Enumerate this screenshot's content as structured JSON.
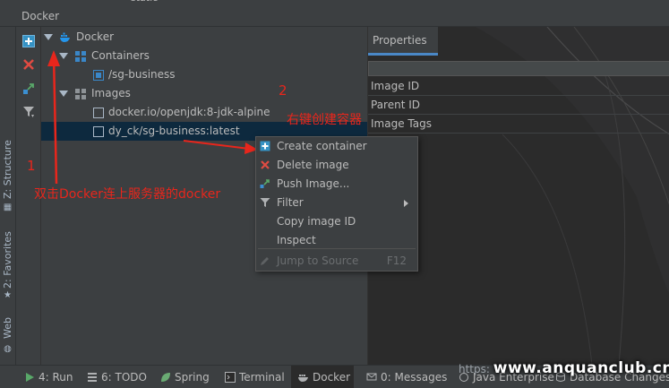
{
  "window": {
    "title": "Docker",
    "top_fragment": "static"
  },
  "left_strip": {
    "tabs": [
      {
        "label": "Z: Structure"
      },
      {
        "label": "2: Favorites"
      },
      {
        "label": "Web"
      }
    ]
  },
  "toolbar": {
    "buttons": [
      {
        "name": "add",
        "icon": "plus-icon"
      },
      {
        "name": "remove",
        "icon": "red-x-icon"
      },
      {
        "name": "connect",
        "icon": "arrow-diagonal-icon"
      },
      {
        "name": "filter",
        "icon": "filter-funnel-icon"
      }
    ]
  },
  "tree": {
    "root": "Docker",
    "containers_label": "Containers",
    "container_item": "/sg-business",
    "images_label": "Images",
    "image_items": [
      "docker.io/openjdk:8-jdk-alpine",
      "dy_ck/sg-business:latest"
    ]
  },
  "properties": {
    "tab_label": "Properties",
    "rows": [
      "Image ID",
      "Parent ID",
      "Image Tags"
    ]
  },
  "context_menu": {
    "items": [
      {
        "label": "Create container",
        "icon": "plus-square-icon"
      },
      {
        "label": "Delete image",
        "icon": "red-x-icon"
      },
      {
        "label": "Push Image...",
        "icon": "push-arrow-icon"
      },
      {
        "label": "Filter",
        "icon": "filter-funnel-icon",
        "submenu": true
      },
      {
        "label": "Copy image ID"
      },
      {
        "label": "Inspect"
      }
    ],
    "jump": {
      "label": "Jump to Source",
      "shortcut": "F12",
      "icon": "pencil-icon",
      "disabled": true
    }
  },
  "annotations": {
    "step1_number": "1",
    "step1_text": "双击Docker连上服务器的docker",
    "step2_number": "2",
    "step2_text": "右键创建容器",
    "color": "#e8261c"
  },
  "bottom_bar": {
    "tabs": [
      {
        "label": "4: Run",
        "icon": "run-icon"
      },
      {
        "label": "6: TODO",
        "icon": "todo-icon"
      },
      {
        "label": "Spring",
        "icon": "spring-leaf-icon"
      },
      {
        "label": "Terminal",
        "icon": "terminal-icon"
      },
      {
        "label": "Docker",
        "icon": "docker-whale-icon",
        "active": true
      },
      {
        "label": "0: Messages",
        "icon": "messages-icon"
      },
      {
        "label": "Java Enterprise",
        "icon": "java-enterprise-icon"
      },
      {
        "label": "Database Changes",
        "icon": "database-changes-icon"
      }
    ]
  },
  "watermark": {
    "csdn": "https:",
    "site": "www.anquanclub.cn"
  }
}
